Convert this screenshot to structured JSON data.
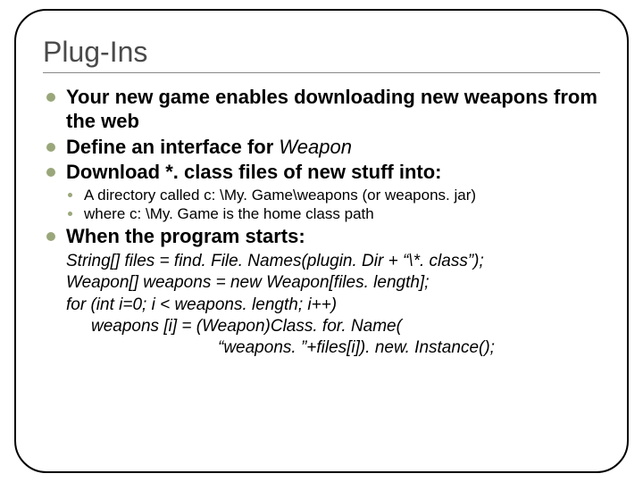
{
  "title": "Plug-Ins",
  "bullets": {
    "b1": "Your new game enables downloading new weapons from the web",
    "b2_pre": "Define an interface for ",
    "b2_ital": "Weapon",
    "b3": "Download *. class files of new stuff into:",
    "b3_sub1": "A directory called c: \\My. Game\\weapons (or weapons. jar)",
    "b3_sub2": "where c: \\My. Game is the home class path",
    "b4": "When the program starts:"
  },
  "code": {
    "l1": "String[] files = find. File. Names(plugin. Dir + “\\*. class”);",
    "l2": "Weapon[] weapons = new Weapon[files. length];",
    "l3": "for (int i=0; i < weapons. length; i++)",
    "l4": "weapons [i] = (Weapon)Class. for. Name(",
    "l5": "“weapons. ”+files[i]). new. Instance();"
  }
}
